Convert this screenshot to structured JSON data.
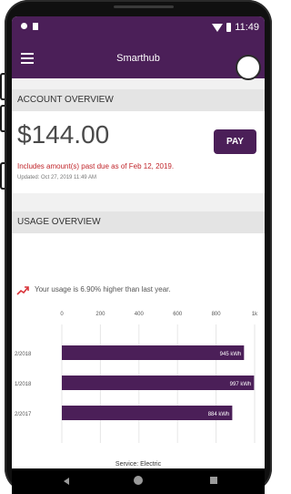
{
  "status_bar": {
    "time": "11:49"
  },
  "app_bar": {
    "title": "Smarthub"
  },
  "account": {
    "header": "ACCOUNT OVERVIEW",
    "amount": "$144.00",
    "pay_label": "PAY",
    "past_due_text": "Includes amount(s) past due as of Feb 12, 2019.",
    "updated_text": "Updated: Oct 27, 2019 11:49 AM"
  },
  "usage": {
    "header": "USAGE OVERVIEW",
    "comparison_text": "Your usage is 6.90% higher than last year.",
    "service_label": "Service: Electric"
  },
  "colors": {
    "brand": "#4b1f58",
    "alert": "#c0262c"
  },
  "icons": {
    "menu": "menu-icon",
    "trend": "trend-up-icon"
  },
  "chart_data": {
    "type": "bar",
    "orientation": "horizontal",
    "categories": [
      "2/2018",
      "1/2018",
      "2/2017"
    ],
    "values": [
      945,
      997,
      884
    ],
    "data_labels": [
      "945 kWh",
      "997 kWh",
      "884 kWh"
    ],
    "x_ticks": [
      "0",
      "200",
      "400",
      "600",
      "800",
      "1k"
    ],
    "xlim": [
      0,
      1000
    ],
    "grid": true
  }
}
